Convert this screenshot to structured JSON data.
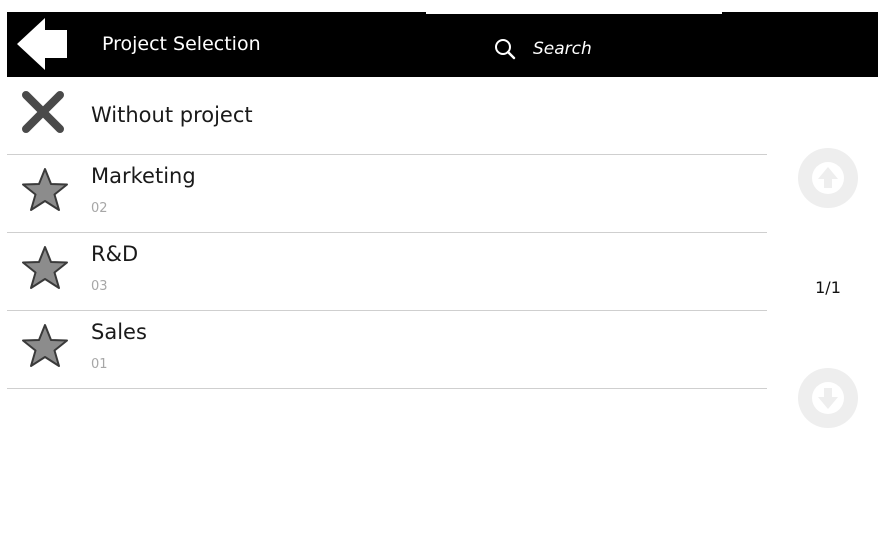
{
  "header": {
    "title": "Project Selection",
    "search_placeholder": "Search"
  },
  "projects": [
    {
      "name": "Without project",
      "code": "",
      "icon": "close-icon"
    },
    {
      "name": "Marketing",
      "code": "02",
      "icon": "star-icon"
    },
    {
      "name": "R&D",
      "code": "03",
      "icon": "star-icon"
    },
    {
      "name": "Sales",
      "code": "01",
      "icon": "star-icon"
    }
  ],
  "pagination": {
    "indicator": "1/1"
  },
  "colors": {
    "header_bg": "#000000",
    "text": "#1a1a1a",
    "code_text": "#a7a7a7",
    "icon_gray": "#8c8c8c",
    "divider": "#cfcfcf",
    "scroll_button": "#eeeeee"
  }
}
